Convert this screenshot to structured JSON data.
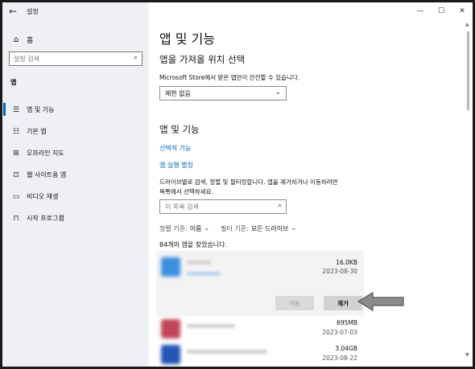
{
  "window": {
    "title": "설정",
    "controls": {
      "minimize": "—",
      "maximize": "☐",
      "close": "✕"
    }
  },
  "sidebar": {
    "home_label": "홈",
    "search_placeholder": "설정 검색",
    "section_label": "앱",
    "items": [
      {
        "label": "앱 및 기능",
        "icon": "list-icon",
        "active": true
      },
      {
        "label": "기본 앱",
        "icon": "default-apps-icon",
        "active": false
      },
      {
        "label": "오프라인 지도",
        "icon": "map-icon",
        "active": false
      },
      {
        "label": "웹 사이트용 앱",
        "icon": "web-apps-icon",
        "active": false
      },
      {
        "label": "비디오 재생",
        "icon": "video-icon",
        "active": false
      },
      {
        "label": "시작 프로그램",
        "icon": "startup-icon",
        "active": false
      }
    ]
  },
  "main": {
    "page_title": "앱 및 기능",
    "install_section": {
      "heading": "앱을 가져올 위치 선택",
      "description": "Microsoft Store에서 받은 앱만이 안전할 수 있습니다.",
      "dropdown_value": "제한 없음"
    },
    "apps_section": {
      "heading": "앱 및 기능",
      "link_optional": "선택적 기능",
      "link_aliases": "앱 실행 별칭",
      "description_line1": "드라이브별로 검색, 정렬 및 필터링합니다. 앱을 제거하거나 이동하려면",
      "description_line2": "목록에서 선택하세요.",
      "search_placeholder": "이 목록 검색",
      "sort_label": "정렬 기준:",
      "sort_value": "이름",
      "filter_label": "필터 기준:",
      "filter_value": "모든 드라이브",
      "count_text": "84개의 앱을 찾았습니다."
    },
    "apps": [
      {
        "size": "16.0KB",
        "date": "2023-08-30",
        "color": "#3a8fe0",
        "selected": true
      },
      {
        "size": "695MB",
        "date": "2023-07-03",
        "color": "#c0455a",
        "selected": false
      },
      {
        "size": "3.04GB",
        "date": "2023-08-22",
        "color": "#2155b8",
        "selected": false
      }
    ],
    "buttons": {
      "move": "이동",
      "remove": "제거"
    }
  },
  "colors": {
    "accent": "#0067c0",
    "sidebar_bg": "#eef0f3",
    "card_bg": "#f3f3f3"
  }
}
